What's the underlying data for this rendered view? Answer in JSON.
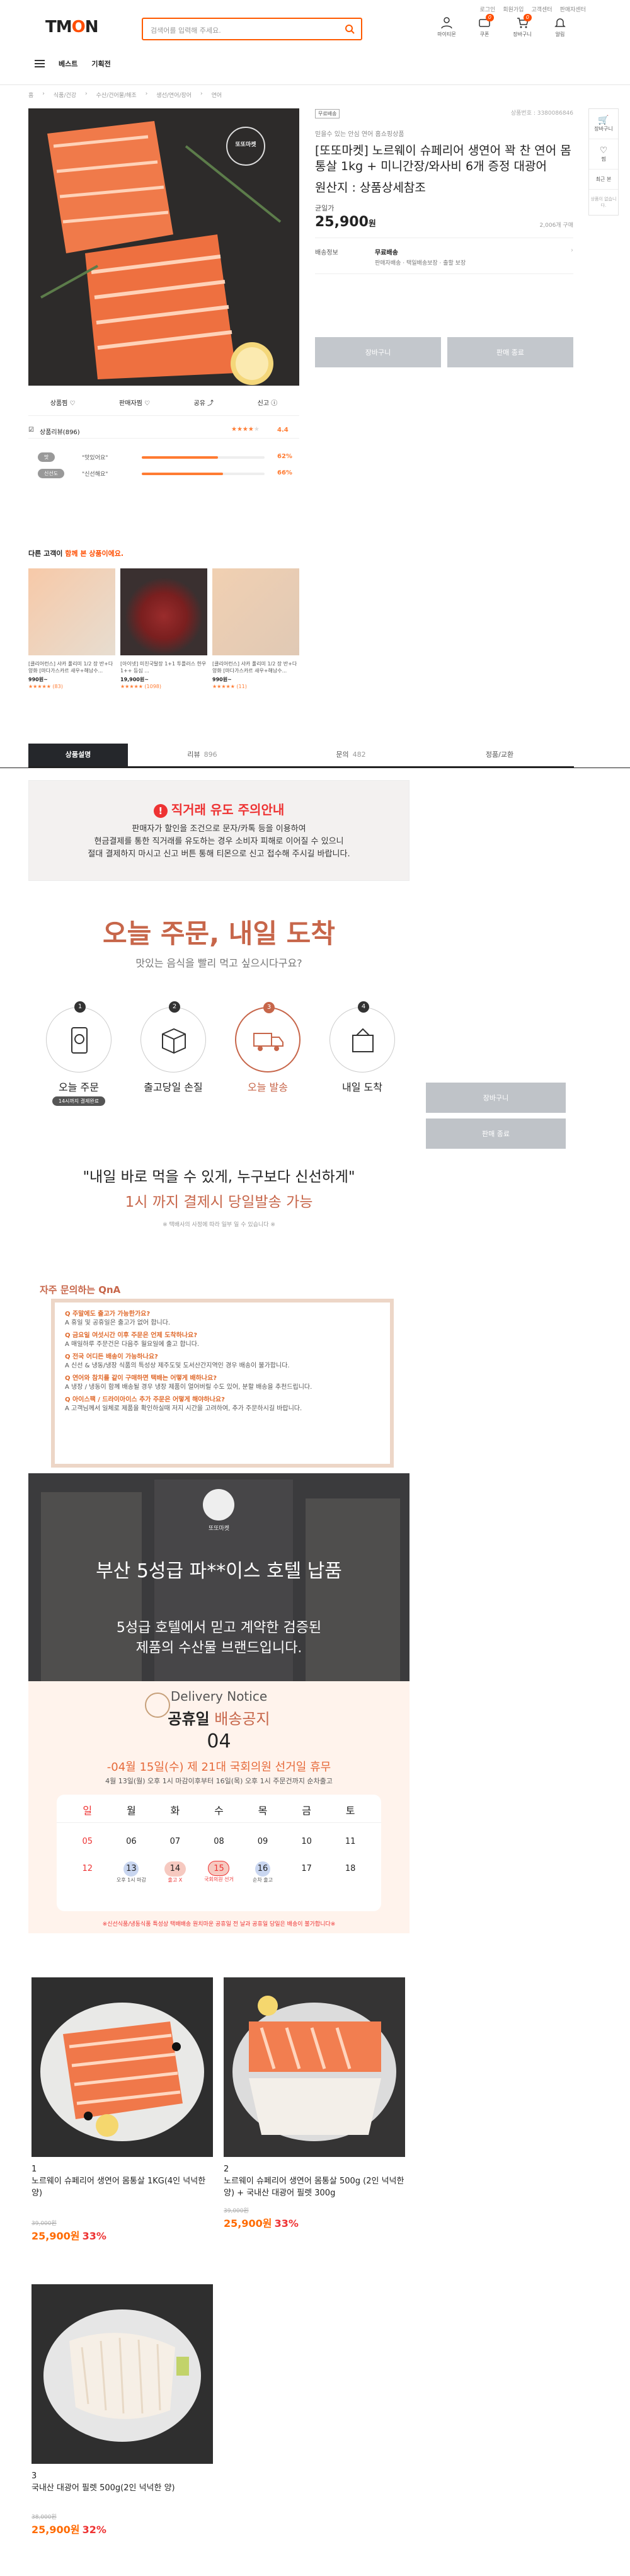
{
  "toplinks": [
    "로그인",
    "회원가입",
    "고객센터",
    "판매자센터"
  ],
  "logo": {
    "part1": "TM",
    "part2": "O",
    "part3": "N"
  },
  "search": {
    "placeholder": "검색어를 입력해 주세요."
  },
  "userbar": [
    {
      "label": "마이티몬",
      "icon": "user-icon",
      "badge": ""
    },
    {
      "label": "쿠폰",
      "icon": "coupon-icon",
      "badge": "0"
    },
    {
      "label": "장바구니",
      "icon": "cart-icon",
      "badge": "0"
    },
    {
      "label": "알림",
      "icon": "bell-icon",
      "badge": ""
    }
  ],
  "nav": {
    "menu_icon": "menu-icon",
    "items": [
      "베스트",
      "기획전"
    ]
  },
  "breadcrumb": [
    "홈",
    "식품/건강",
    "수산/건어물/해조",
    "생선/연어/장어",
    "연어"
  ],
  "product": {
    "image_brand": "또또마켓",
    "brand_tag": "무료배송",
    "product_no": "상품번호 : 3380086846",
    "subtitle": "믿을수 있는 안심 연어 홈쇼핑상품",
    "title": "[또또마켓] 노르웨이 슈페리어 생연어 꽉 찬 연어 몸통살 1kg + 미니간장/와사비 6개 증정 대광어",
    "origin": "원산지 : 상품상세참조",
    "price_label": "균일가",
    "price": "25,900",
    "price_unit": "원",
    "sold": "2,006개 구매",
    "shipping_label": "배송정보",
    "shipping_value": "무료배송",
    "shipping_detail": "판매자배송 · 택일배송보장 · 출할 보장",
    "cart_button": "장바구니",
    "buy_button": "판매 종료"
  },
  "options": [
    {
      "label": "상품찜",
      "icon": "heart-icon"
    },
    {
      "label": "판매자찜",
      "icon": "heart-icon"
    },
    {
      "label": "공유",
      "icon": "share-icon"
    },
    {
      "label": "신고",
      "icon": "alert-icon"
    }
  ],
  "review": {
    "title": "상품리뷰(896)",
    "score": "4.4",
    "rows": [
      {
        "tag": "맛",
        "text": "\"맛있어요\"",
        "pct": "62%",
        "value": 0.62
      },
      {
        "tag": "신선도",
        "text": "\"신선해요\"",
        "pct": "66%",
        "value": 0.66
      }
    ]
  },
  "rail": [
    "장바구니",
    "찜",
    "최근 본",
    "상품이 없습니다."
  ],
  "others": {
    "title_part1": "다른 고객이",
    "title_part2": " 함께 본 상품이에요.",
    "cards": [
      {
        "text": "[클리어런스] 샤카 풀리미 1/2 장 반+다양화 [마다가스카르 새우+해남수...",
        "price": "990원~",
        "rating": "★★★★★ (83)"
      },
      {
        "text": "[아이넷] 미친국탈장 1+1 투플러스 한우 1++ 등심 ...",
        "price": "19,900원~",
        "rating": "★★★★★ (1098)"
      },
      {
        "text": "[클리어런스] 샤카 풀리미 1/2 장 반+다양화 [마다가스카르 새우+해남수...",
        "price": "990원~",
        "rating": "★★★★★ (11)"
      }
    ]
  },
  "tabs": [
    {
      "label": "상품설명",
      "count": ""
    },
    {
      "label": "리뷰",
      "count": "896"
    },
    {
      "label": "문의",
      "count": "482"
    },
    {
      "label": "정품/교환",
      "count": ""
    }
  ],
  "scam": {
    "title": "직거래 유도 주의안내",
    "body": [
      "판매자가 할인을 조건으로 문자/카톡 등을 이용하여",
      "현금결제를 통한 직거래를 유도하는 경우 소비자 피해로 이어질 수 있으니",
      "절대 결제하지 마시고 신고 버튼 통해 티몬으로 신고 접수해 주시길 바랍니다."
    ]
  },
  "sidebuttons": [
    "장바구니",
    "판매 종료"
  ],
  "headline": {
    "title": "오늘 주문, 내일 도착",
    "sub": "맛있는 음식을 빨리 먹고 싶으시다구요?"
  },
  "steps": [
    {
      "n": "1",
      "label": "오늘 주문",
      "tag": "14시까지 결제완료",
      "icon": "phone-order-icon"
    },
    {
      "n": "2",
      "label": "출고당일 손질",
      "tag": "",
      "icon": "box-icon"
    },
    {
      "n": "3",
      "label": "오늘 발송",
      "tag": "",
      "icon": "truck-icon"
    },
    {
      "n": "4",
      "label": "내일 도착",
      "tag": "",
      "icon": "package-icon"
    }
  ],
  "quote": {
    "line1": "\"내일 바로 먹을 수 있게, 누구보다 신선하게\"",
    "line2": "1시 까지 결제시 당일발송 가능",
    "note": "※ 택배사의 사정에 따라 일부 일 수 있습니다 ※"
  },
  "faq": {
    "title": "자주 문의하는 QnA",
    "items": [
      {
        "q": "Q 주말에도 출고가 가능한가요?",
        "a": "A 휴일 및 공휴일은 출고가 없어 합니다."
      },
      {
        "q": "Q 금요일 여섯시간 이후 주문은 언제 도착하나요?",
        "a": "A 매일하루 주문건은 다음주 월요일에 출고 합니다."
      },
      {
        "q": "Q 전국 어디든 배송이 가능하나요?",
        "a": "A 신선 & 냉동/냉장 식품의 특성상 제주도및 도서산간지역인 경우 배송이 불가합니다."
      },
      {
        "q": "Q 연어와 참치를 같이 구매하면 택배는 어떻게 배하나요?",
        "a": "A 냉장 / 냉동이 함께 배송될 경우 냉장 제품이 얼어버릴 수도 있어, 분할 배송을 추천드립니다."
      },
      {
        "q": "Q 아이스팩 / 드라이아이스 추가 주문은 어떻게 해야하나요?",
        "a": "A 고객님께서 일체로 제품을 확인하실때 저지 시간을 고려하여, 추가 주문하시길 바랍니다."
      }
    ]
  },
  "hotel": {
    "brand": "또또마켓",
    "title": "부산 5성급 파**이스 호텔 납품",
    "line1": "5성급 호텔에서 믿고 계약한 검증된",
    "line2": "제품의 수산물 브랜드입니다."
  },
  "notice": {
    "eng": "Delivery Notice",
    "title_part1": "공휴일",
    "title_part2": " 배송공지",
    "month": "04",
    "headline": "-04월 15일(수) 제 21대 국회의원 선거일 휴무",
    "sub": "4월 13일(월) 오후 1시 마감이후부터 16일(목) 오후 1시 주문건까지 순차출고",
    "days": [
      "일",
      "월",
      "화",
      "수",
      "목",
      "금",
      "토"
    ],
    "week1": [
      "05",
      "06",
      "07",
      "08",
      "09",
      "10",
      "11"
    ],
    "week2": [
      "12",
      "13",
      "14",
      "15",
      "16",
      "17",
      "18"
    ],
    "marks": {
      "d13": "오후 1시 마감",
      "d14": "출고 X",
      "d15": "국회의원 선거",
      "d16": "순차 출고"
    },
    "footer": "※신선식품/냉동식품 특성상 택배배송 원치마운 공휴일 전 날과 공휴일 당일은 배송이 불가합니다※"
  },
  "products": [
    {
      "n": "1",
      "name": "노르웨이 슈페리어 생연어 몸통살 1KG(4인 넉넉한 양)",
      "orig": "39,000원",
      "price": "25,900원",
      "pct": "33%"
    },
    {
      "n": "2",
      "name": "노르웨이 슈페리어 생연어 몸통살 500g (2인 넉넉한 양) + 국내산 대광어 필렛 300g",
      "orig": "39,000원",
      "price": "25,900원",
      "pct": "33%"
    },
    {
      "n": "3",
      "name": "국내산 대광어 필렛 500g(2인 넉넉한 양)",
      "orig": "38,000원",
      "price": "25,900원",
      "pct": "32%"
    }
  ],
  "colors": {
    "accent": "#ff4d00",
    "salmon_text": "#c7664a"
  }
}
